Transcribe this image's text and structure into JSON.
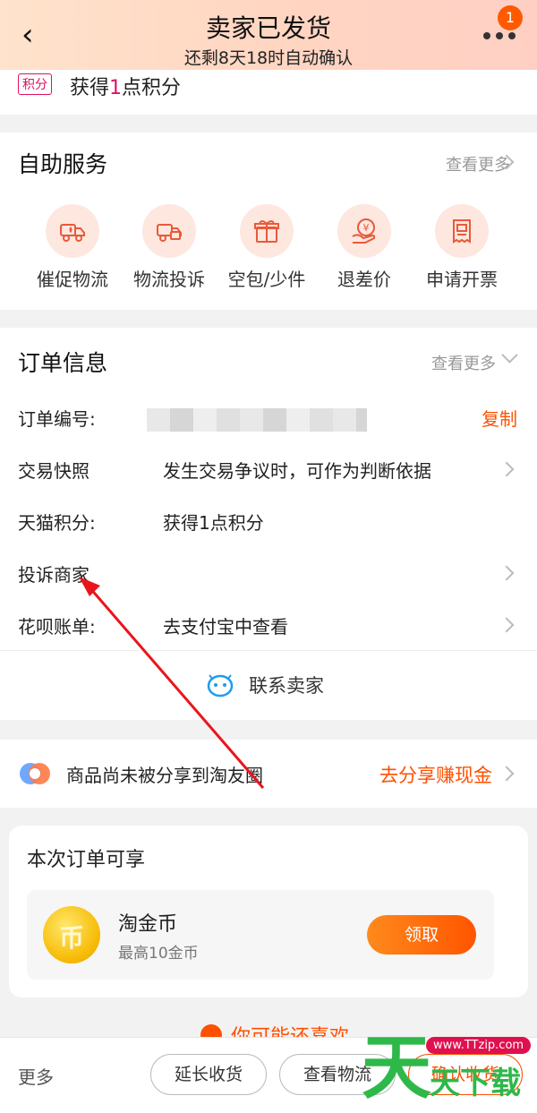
{
  "header": {
    "title": "卖家已发货",
    "subtitle": "还剩8天18时自动确认",
    "badge_count": "1"
  },
  "points_row": {
    "tag": "积分",
    "text_prefix": "获得",
    "number": "1",
    "text_suffix": "点积分"
  },
  "self_service": {
    "title": "自助服务",
    "more": "查看更多",
    "items": [
      {
        "label": "催促物流",
        "icon": "truck-drop-icon"
      },
      {
        "label": "物流投诉",
        "icon": "truck-complaint-icon"
      },
      {
        "label": "空包/少件",
        "icon": "gift-box-icon"
      },
      {
        "label": "退差价",
        "icon": "yen-refund-icon"
      },
      {
        "label": "申请开票",
        "icon": "invoice-icon"
      }
    ]
  },
  "order_info": {
    "title": "订单信息",
    "more": "查看更多",
    "rows": [
      {
        "key": "订单编号:",
        "value": "",
        "action": "复制"
      },
      {
        "key": "交易快照",
        "value": "发生交易争议时，可作为判断依据"
      },
      {
        "key": "天猫积分:",
        "value": "获得1点积分"
      },
      {
        "key": "投诉商家",
        "value": ""
      },
      {
        "key": "花呗账单:",
        "value": "去支付宝中查看"
      }
    ],
    "contact": "联系卖家"
  },
  "share": {
    "text": "商品尚未被分享到淘友圈",
    "cta": "去分享赚现金"
  },
  "benefits": {
    "title": "本次订单可享",
    "coin_name": "淘金币",
    "coin_desc": "最高10金币",
    "claim": "领取"
  },
  "may_like": "你可能还喜欢",
  "bottom_bar": {
    "more": "更多",
    "extend": "延长收货",
    "logistics": "查看物流",
    "confirm": "确认收货"
  },
  "watermark": {
    "big": "天",
    "url": "www.TTzip.com",
    "sub": "天下载"
  },
  "colors": {
    "accent": "#ff5000",
    "annotation_arrow": "#e8161c"
  }
}
